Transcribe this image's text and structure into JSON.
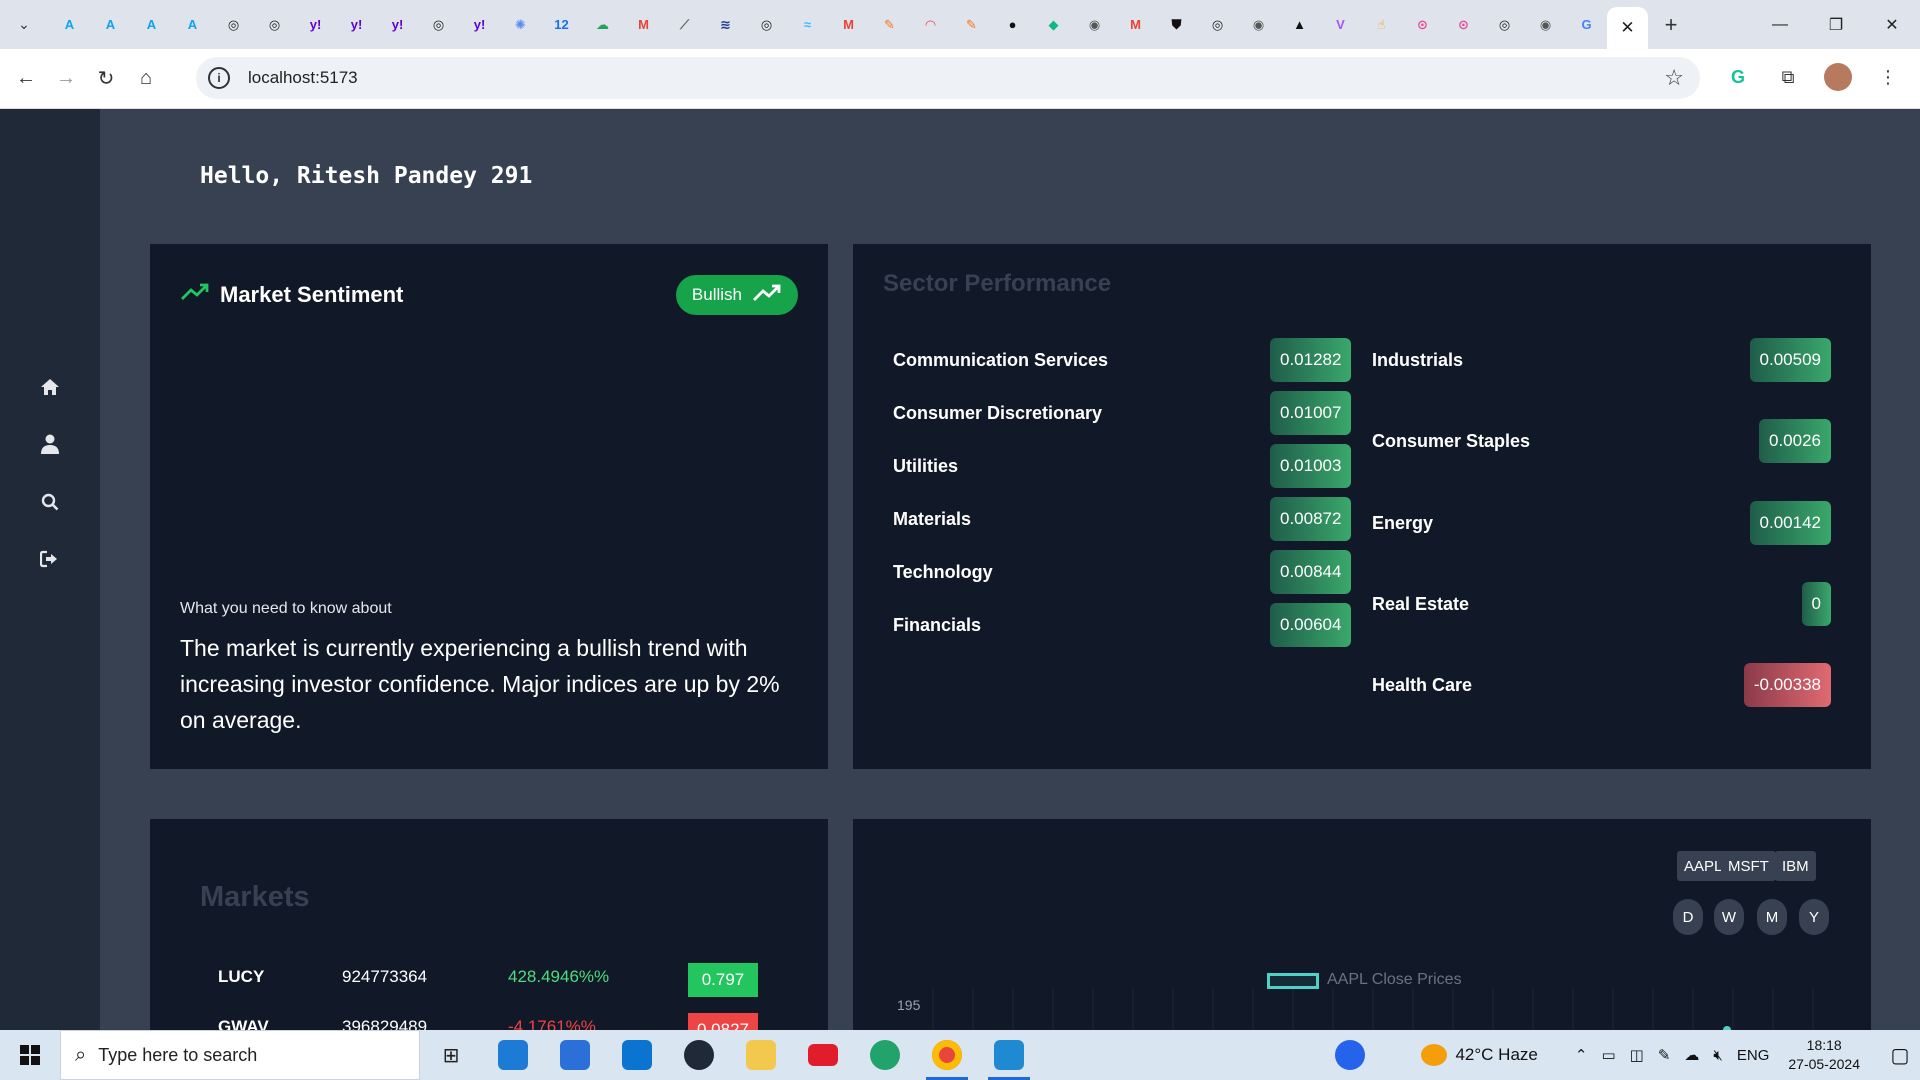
{
  "browser": {
    "url": "localhost:5173",
    "active_tab_close": "✕",
    "new_tab": "+",
    "favicons": [
      {
        "icon": "azure-icon",
        "glyph": "A",
        "color": "#0ea5e9"
      },
      {
        "icon": "azure-icon",
        "glyph": "A",
        "color": "#0ea5e9"
      },
      {
        "icon": "azure-icon",
        "glyph": "A",
        "color": "#0ea5e9"
      },
      {
        "icon": "azure-icon",
        "glyph": "A",
        "color": "#0ea5e9"
      },
      {
        "icon": "chatgpt-icon",
        "glyph": "◎",
        "color": "#222"
      },
      {
        "icon": "chatgpt-icon",
        "glyph": "◎",
        "color": "#222"
      },
      {
        "icon": "yahoo-icon",
        "glyph": "y!",
        "color": "#6001d2"
      },
      {
        "icon": "yahoo-icon",
        "glyph": "y!",
        "color": "#6001d2"
      },
      {
        "icon": "yahoo-icon",
        "glyph": "y!",
        "color": "#6001d2"
      },
      {
        "icon": "chatgpt-icon",
        "glyph": "◎",
        "color": "#222"
      },
      {
        "icon": "yahoo-icon",
        "glyph": "y!",
        "color": "#6001d2"
      },
      {
        "icon": "gemini-icon",
        "glyph": "✺",
        "color": "#5b8def"
      },
      {
        "icon": "calendar-icon",
        "glyph": "12",
        "color": "#1a73e8"
      },
      {
        "icon": "cloud-icon",
        "glyph": "☁",
        "color": "#22a35a"
      },
      {
        "icon": "gmail-icon",
        "glyph": "M",
        "color": "#ea4335"
      },
      {
        "icon": "chart-icon",
        "glyph": "⟋",
        "color": "#666"
      },
      {
        "icon": "stack-icon",
        "glyph": "≋",
        "color": "#1e3a8a"
      },
      {
        "icon": "chatgpt-icon",
        "glyph": "◎",
        "color": "#222"
      },
      {
        "icon": "tailwind-icon",
        "glyph": "≈",
        "color": "#38bdf8"
      },
      {
        "icon": "gmail-icon",
        "glyph": "M",
        "color": "#ea4335"
      },
      {
        "icon": "postman-icon",
        "glyph": "✎",
        "color": "#f97316"
      },
      {
        "icon": "rainbow-icon",
        "glyph": "◠",
        "color": "#ef4444"
      },
      {
        "icon": "postman-icon",
        "glyph": "✎",
        "color": "#f97316"
      },
      {
        "icon": "github-icon",
        "glyph": "●",
        "color": "#111"
      },
      {
        "icon": "diamond-icon",
        "glyph": "◆",
        "color": "#10b981"
      },
      {
        "icon": "globe-icon",
        "glyph": "◉",
        "color": "#555"
      },
      {
        "icon": "gmail-icon",
        "glyph": "M",
        "color": "#ea4335"
      },
      {
        "icon": "shield-icon",
        "glyph": "⛊",
        "color": "#111"
      },
      {
        "icon": "chatgpt-icon",
        "glyph": "◎",
        "color": "#222"
      },
      {
        "icon": "globe-icon",
        "glyph": "◉",
        "color": "#555"
      },
      {
        "icon": "vercel-icon",
        "glyph": "▲",
        "color": "#111"
      },
      {
        "icon": "vite-icon",
        "glyph": "V",
        "color": "#a855f7"
      },
      {
        "icon": "hand-icon",
        "glyph": "☝",
        "color": "#f59e0b"
      },
      {
        "icon": "link-icon",
        "glyph": "⊙",
        "color": "#ec4899"
      },
      {
        "icon": "link-icon",
        "glyph": "⊙",
        "color": "#ec4899"
      },
      {
        "icon": "chatgpt-icon",
        "glyph": "◎",
        "color": "#222"
      },
      {
        "icon": "globe-icon",
        "glyph": "◉",
        "color": "#555"
      },
      {
        "icon": "google-icon",
        "glyph": "G",
        "color": "#4285f4"
      }
    ]
  },
  "app": {
    "greeting": "Hello, Ritesh Pandey 291",
    "sidebar": [
      "home-icon",
      "user-icon",
      "search-icon",
      "logout-icon"
    ],
    "sentiment": {
      "title": "Market Sentiment",
      "badge": "Bullish",
      "know_label": "What you need to know about",
      "summary": "The market is currently experiencing a bullish trend with increasing investor confidence. Major indices are up by 2% on average."
    },
    "sectors": {
      "title": "Sector Performance",
      "left": [
        {
          "name": "Communication Services",
          "value": "0.01282"
        },
        {
          "name": "Consumer Discretionary",
          "value": "0.01007"
        },
        {
          "name": "Utilities",
          "value": "0.01003"
        },
        {
          "name": "Materials",
          "value": "0.00872"
        },
        {
          "name": "Technology",
          "value": "0.00844"
        },
        {
          "name": "Financials",
          "value": "0.00604"
        }
      ],
      "right": [
        {
          "name": "Industrials",
          "value": "0.00509"
        },
        {
          "name": "Consumer Staples",
          "value": "0.0026"
        },
        {
          "name": "Energy",
          "value": "0.00142"
        },
        {
          "name": "Real Estate",
          "value": "0"
        },
        {
          "name": "Health Care",
          "value": "-0.00338"
        }
      ]
    },
    "markets": {
      "title": "Markets",
      "rows": [
        {
          "symbol": "LUCY",
          "volume": "924773364",
          "change": "428.4946%%",
          "price": "0.797",
          "up": true
        },
        {
          "symbol": "GWAV",
          "volume": "396829489",
          "change": "-4.1761%%",
          "price": "0.0827",
          "up": false
        }
      ]
    },
    "chart": {
      "symbols": [
        "AAPL",
        "MSFT",
        "IBM"
      ],
      "ranges": [
        "D",
        "W",
        "M",
        "Y"
      ],
      "legend": "AAPL Close Prices",
      "ytick": "195",
      "line_color": "#4fd1c5"
    }
  },
  "taskbar": {
    "search_placeholder": "Type here to search",
    "weather": "42°C  Haze",
    "lang": "ENG",
    "time": "18:18",
    "date": "27-05-2024"
  }
}
